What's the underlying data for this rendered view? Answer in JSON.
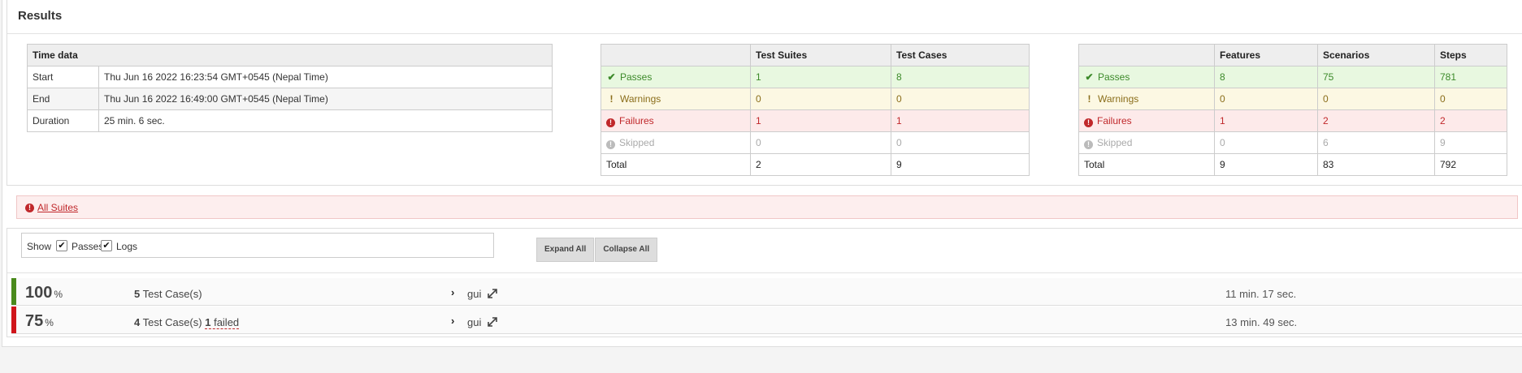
{
  "results": {
    "title": "Results",
    "time_table": {
      "header": "Time data",
      "rows": [
        {
          "label": "Start",
          "value": "Thu Jun 16 2022 16:23:54 GMT+0545 (Nepal Time)"
        },
        {
          "label": "End",
          "value": "Thu Jun 16 2022 16:49:00 GMT+0545 (Nepal Time)"
        },
        {
          "label": "Duration",
          "value": "25 min. 6 sec."
        }
      ]
    },
    "suite_table": {
      "headers": [
        "",
        "Test Suites",
        "Test Cases"
      ],
      "rows": [
        {
          "label": "Passes",
          "values": [
            "1",
            "8"
          ]
        },
        {
          "label": "Warnings",
          "values": [
            "0",
            "0"
          ]
        },
        {
          "label": "Failures",
          "values": [
            "1",
            "1"
          ]
        },
        {
          "label": "Skipped",
          "values": [
            "0",
            "0"
          ]
        },
        {
          "label": "Total",
          "values": [
            "2",
            "9"
          ]
        }
      ]
    },
    "feature_table": {
      "headers": [
        "",
        "Features",
        "Scenarios",
        "Steps"
      ],
      "rows": [
        {
          "label": "Passes",
          "values": [
            "8",
            "75",
            "781"
          ]
        },
        {
          "label": "Warnings",
          "values": [
            "0",
            "0",
            "0"
          ]
        },
        {
          "label": "Failures",
          "values": [
            "1",
            "2",
            "2"
          ]
        },
        {
          "label": "Skipped",
          "values": [
            "0",
            "6",
            "9"
          ]
        },
        {
          "label": "Total",
          "values": [
            "9",
            "83",
            "792"
          ]
        }
      ]
    }
  },
  "all_suites": {
    "label": "All Suites",
    "status_color": "#c0282b"
  },
  "filters": {
    "show_label": "Show",
    "passes_label": "Passes",
    "logs_label": "Logs",
    "passes_checked": true,
    "logs_checked": true
  },
  "buttons": {
    "expand_all": "Expand All",
    "collapse_all": "Collapse All"
  },
  "suites": [
    {
      "percent": "100",
      "percent_unit": "%",
      "count": "5",
      "cases_label": "Test Case(s)",
      "failed_count": "",
      "failed_label": "",
      "name": "gui",
      "duration": "11 min. 17 sec.",
      "status_color": "#4a8a1c"
    },
    {
      "percent": "75",
      "percent_unit": "%",
      "count": "4",
      "cases_label": "Test Case(s)",
      "failed_count": "1",
      "failed_label": "failed",
      "name": "gui",
      "duration": "13 min. 49 sec.",
      "status_color": "#d0151b"
    }
  ],
  "colors": {
    "pass": "#3c8a2a",
    "warn": "#8a6d1a",
    "fail": "#c0282b",
    "skip": "#aaaaaa"
  },
  "icons": {
    "pass": "check-icon",
    "warn": "exclamation-icon",
    "fail": "error-circle-icon",
    "skip": "skip-circle-icon",
    "expand": "expand-arrows-icon",
    "chevron": "chevron-right-icon"
  }
}
